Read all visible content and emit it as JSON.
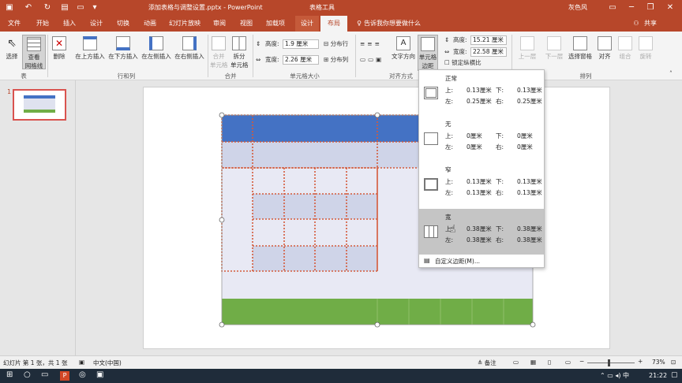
{
  "titlebar": {
    "filename": "添加表格与调整设置.pptx - PowerPoint",
    "context_tool": "表格工具",
    "user": "灰色风",
    "bg": "#b7472a"
  },
  "tabs": [
    "文件",
    "开始",
    "插入",
    "设计",
    "切换",
    "动画",
    "幻灯片放映",
    "审阅",
    "视图",
    "加载项",
    "设计",
    "布局"
  ],
  "tell_me": "告诉我你想要做什么",
  "share": "共享",
  "ribbon": {
    "select": "选择",
    "gridlines": "查看\n网格线",
    "gridlines_l1": "查看",
    "gridlines_l2": "网格线",
    "delete": "删除",
    "insert_above": "在上方插入",
    "insert_below": "在下方插入",
    "insert_left": "在左侧插入",
    "insert_right": "在右侧插入",
    "merge_l1": "合并",
    "merge_l2": "单元格",
    "split_l1": "拆分",
    "split_l2": "单元格",
    "height_label": "高度:",
    "height_value": "1.9 厘米",
    "width_label": "宽度:",
    "width_value": "2.26 厘米",
    "distribute_rows": "分布行",
    "distribute_cols": "分布列",
    "text_direction": "文字方向",
    "cell_margins_l1": "单元格",
    "cell_margins_l2": "边距",
    "tbl_height_label": "高度:",
    "tbl_height_value": "15.21 厘米",
    "tbl_width_label": "宽度:",
    "tbl_width_value": "22.58 厘米",
    "lock_ratio": "锁定纵横比",
    "bring_forward": "上一层",
    "send_backward": "下一层",
    "selection_pane": "选择窗格",
    "align": "对齐",
    "group": "组合",
    "rotate": "旋转",
    "groups": {
      "table": "表",
      "rows_cols": "行和列",
      "merge": "合并",
      "cell_size": "单元格大小",
      "alignment": "对齐方式",
      "arrange": "排列"
    }
  },
  "thumbnail_number": "1",
  "dropdown": {
    "options": [
      {
        "name": "正常",
        "top_l": "上:",
        "top_v": "0.13厘米",
        "bot_l": "下:",
        "bot_v": "0.13厘米",
        "left_l": "左:",
        "left_v": "0.25厘米",
        "right_l": "右:",
        "right_v": "0.25厘米"
      },
      {
        "name": "无",
        "top_l": "上:",
        "top_v": "0厘米",
        "bot_l": "下:",
        "bot_v": "0厘米",
        "left_l": "左:",
        "left_v": "0厘米",
        "right_l": "右:",
        "right_v": "0厘米"
      },
      {
        "name": "窄",
        "top_l": "上:",
        "top_v": "0.13厘米",
        "bot_l": "下:",
        "bot_v": "0.13厘米",
        "left_l": "左:",
        "left_v": "0.13厘米",
        "right_l": "右:",
        "right_v": "0.13厘米"
      },
      {
        "name": "宽",
        "top_l": "上:",
        "top_v": "0.38厘米",
        "bot_l": "下:",
        "bot_v": "0.38厘米",
        "left_l": "左:",
        "left_v": "0.38厘米",
        "right_l": "右:",
        "right_v": "0.38厘米"
      }
    ],
    "custom": "自定义边距(M)..."
  },
  "status": {
    "slide_info": "幻灯片 第 1 张，共 1 张",
    "language": "中文(中国)",
    "notes": "备注",
    "zoom": "73%"
  },
  "taskbar": {
    "time": "21:22"
  },
  "colors": {
    "header_blue": "#4472c4",
    "band_light": "#cfd4e8",
    "band_pale": "#e8e9f4",
    "footer_green": "#70ad47",
    "selection_red": "#c0504d"
  }
}
